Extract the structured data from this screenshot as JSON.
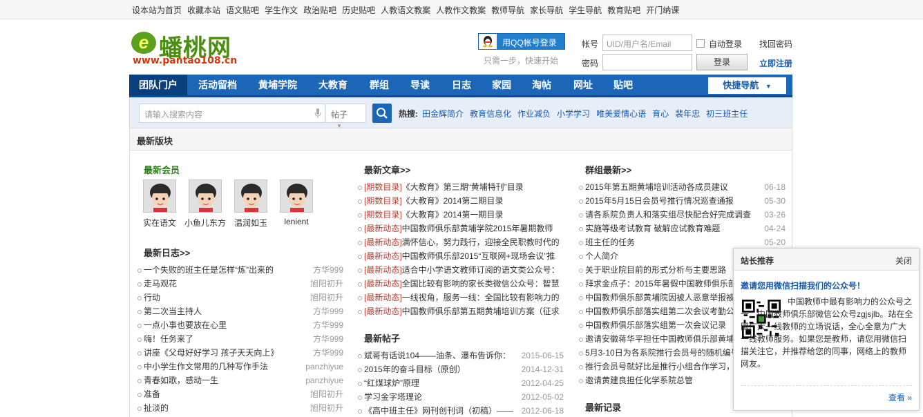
{
  "topbar": {
    "links": [
      "设本站为首页",
      "收藏本站",
      "语文贴吧",
      "学生作文",
      "政治贴吧",
      "历史贴吧",
      "人教语文教案",
      "人教作文教案",
      "教师导航",
      "家长导航",
      "学生导航",
      "教育贴吧",
      "开门纳课"
    ]
  },
  "logo": {
    "letter": "e",
    "name": "蟠桃网",
    "url": "www.pantao108.cn"
  },
  "login": {
    "qq_button": "用QQ帐号登录",
    "qq_tip": "只需一步，快速开始",
    "account_label": "帐号",
    "account_placeholder": "UID/用户名/Email",
    "password_label": "密码",
    "auto_login": "自动登录",
    "login_button": "登录",
    "find_password": "找回密码",
    "register": "立即注册"
  },
  "nav": {
    "items": [
      "团队门户",
      "活动留档",
      "黄埔学院",
      "大教育",
      "群组",
      "导读",
      "日志",
      "家园",
      "淘帖",
      "网址",
      "贴吧"
    ],
    "quick": "快捷导航"
  },
  "search": {
    "placeholder": "请输入搜索内容",
    "type": "帖子",
    "hot_label": "热搜:",
    "hot": [
      "田金辉简介",
      "教育信息化",
      "作业减负",
      "小学学习",
      "唯美爱情心语",
      "育心",
      "裴年忠",
      "初三班主任"
    ]
  },
  "panel": {
    "title": "最新版块"
  },
  "members": {
    "title": "最新会员",
    "items": [
      "实在语文",
      "小鱼儿东方",
      "温润如玉",
      "lenient"
    ]
  },
  "blogs": {
    "title": "最新日志>>",
    "items": [
      {
        "t": "一个失败的班主任是怎样“炼”出来的",
        "a": "方华999"
      },
      {
        "t": "走马观花",
        "a": "旭阳初升"
      },
      {
        "t": "行动",
        "a": "旭阳初升"
      },
      {
        "t": "第二次当主持人",
        "a": "方华999"
      },
      {
        "t": "一点小事也要放在心里",
        "a": "方华999"
      },
      {
        "t": "嗨！任务来了",
        "a": "方华999"
      },
      {
        "t": "讲座《父母好好学习 孩子天天向上》",
        "a": "方华999"
      },
      {
        "t": "中小学生作文常用的几种写作手法",
        "a": "panzhiyue"
      },
      {
        "t": "青春如歌，感动一生",
        "a": "panzhiyue"
      },
      {
        "t": "准备",
        "a": "旭阳初升"
      },
      {
        "t": "扯淡的",
        "a": "旭阳初升"
      }
    ]
  },
  "articles": {
    "title": "最新文章>>",
    "items": [
      {
        "tag": "[期数目录]",
        "t": "《大教育》第三期“黄埔特刊”目录"
      },
      {
        "tag": "[期数目录]",
        "t": "《大教育》2014第二期目录"
      },
      {
        "tag": "[期数目录]",
        "t": "《大教育》2014第一期目录"
      },
      {
        "tag": "[最新动态]",
        "t": "中国教师俱乐部黄埔学院2015年暑期教师"
      },
      {
        "tag": "[最新动态]",
        "t": "满怀信心，努力践行，迎接全民职教时代的"
      },
      {
        "tag": "[最新动态]",
        "t": "中国教师俱乐部2015“互联网+现场会议”推"
      },
      {
        "tag": "[最新动态]",
        "t": "适合中小学语文教师订阅的语文类公众号："
      },
      {
        "tag": "[最新动态]",
        "t": "全国比较有影响的家长类微信公众号：智慧"
      },
      {
        "tag": "[最新动态]",
        "t": "一线视角，服务一线：全国比较有影响力的"
      },
      {
        "tag": "[最新动态]",
        "t": "中国教师俱乐部第五期黄埔培训方案（征求"
      }
    ]
  },
  "posts": {
    "title": "最新帖子",
    "items": [
      {
        "t": "斌哥有话说104——油条、瀑布告诉你：",
        "d": "2015-06-15"
      },
      {
        "t": "2015年的奋斗目标（原创）",
        "d": "2014-12-31"
      },
      {
        "t": "“红煤球炉”原理",
        "d": "2012-04-25"
      },
      {
        "t": "学习金字塔理论",
        "d": "2012-05-02"
      },
      {
        "t": "《高中班主任》网刊创刊词（初稿）——",
        "d": "2012-06-18"
      }
    ]
  },
  "groups": {
    "title": "群组最新>>",
    "items": [
      {
        "t": "2015年第五期黄埔培训活动各成员建议",
        "d": "06-18"
      },
      {
        "t": "2015年5月15日会员号推行情况巡查通报",
        "d": "05-30"
      },
      {
        "t": "请各系院负责人和落实组尽快配合好完成调查",
        "d": "03-26"
      },
      {
        "t": "实施等级考试教育 破解应试教育难题",
        "d": "04-24"
      },
      {
        "t": "班主任的任务",
        "d": "05-20"
      },
      {
        "t": "个人简介",
        "d": ""
      },
      {
        "t": "关于职业院目前的形式分析与主要思路",
        "d": ""
      },
      {
        "t": "拜求金点子：2015年暑假中国教师俱乐部",
        "d": ""
      },
      {
        "t": "中国教师俱乐部黄埔院因被人恶意举报被",
        "d": ""
      },
      {
        "t": "中国教师俱乐部落实组第二次会议考勤公",
        "d": ""
      },
      {
        "t": "中国教师俱乐部落实组第一次会议记录",
        "d": ""
      },
      {
        "t": "邀请安徽蒋华平担任中国教师俱乐部黄埔",
        "d": ""
      },
      {
        "t": "5月3-10日为各系院推行会员号的随机编号",
        "d": ""
      },
      {
        "t": "推行会员号就好比是推行小组合作学习，",
        "d": ""
      },
      {
        "t": "邀请黄建良担任化学系院总管",
        "d": ""
      }
    ]
  },
  "records": {
    "title": "最新记录"
  },
  "popup": {
    "title": "站长推荐",
    "close": "关闭",
    "subtitle": "邀请您用微信扫描我们的公众号！",
    "desc": "中国教师中最有影响力的公众号之一：中国教师俱乐部微信公众号zgjsjlb。站在全国广大一线教师的立场说话，全心全意为广大一线教师服务。如果您是教师，请您用微信扫描关注它，并推荐给您的同事，网络上的教师网友。",
    "more": "查看 »"
  },
  "colors": {
    "nav": "#1c66b8",
    "link": "#1a5aa8",
    "tag": "#c0392b",
    "member_title": "#2d7e18"
  }
}
